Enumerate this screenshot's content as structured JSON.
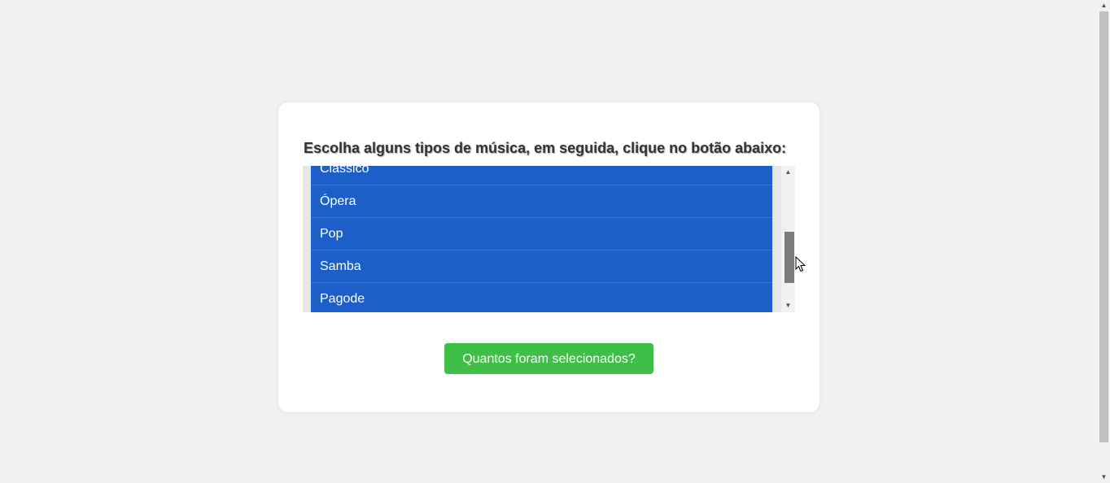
{
  "main": {
    "prompt": "Escolha alguns tipos de música, em seguida, clique no botão abaixo:",
    "music_select": {
      "options": [
        "Clássico",
        "Ópera",
        "Pop",
        "Samba",
        "Pagode"
      ],
      "selected_color": "#1c5fc9"
    },
    "count_button_label": "Quantos foram selecionados?",
    "button_color": "#3fbf48"
  },
  "icons": {
    "scroll_up": "triangle-up-icon",
    "scroll_down": "triangle-down-icon",
    "pointer": "mouse-cursor-icon"
  }
}
